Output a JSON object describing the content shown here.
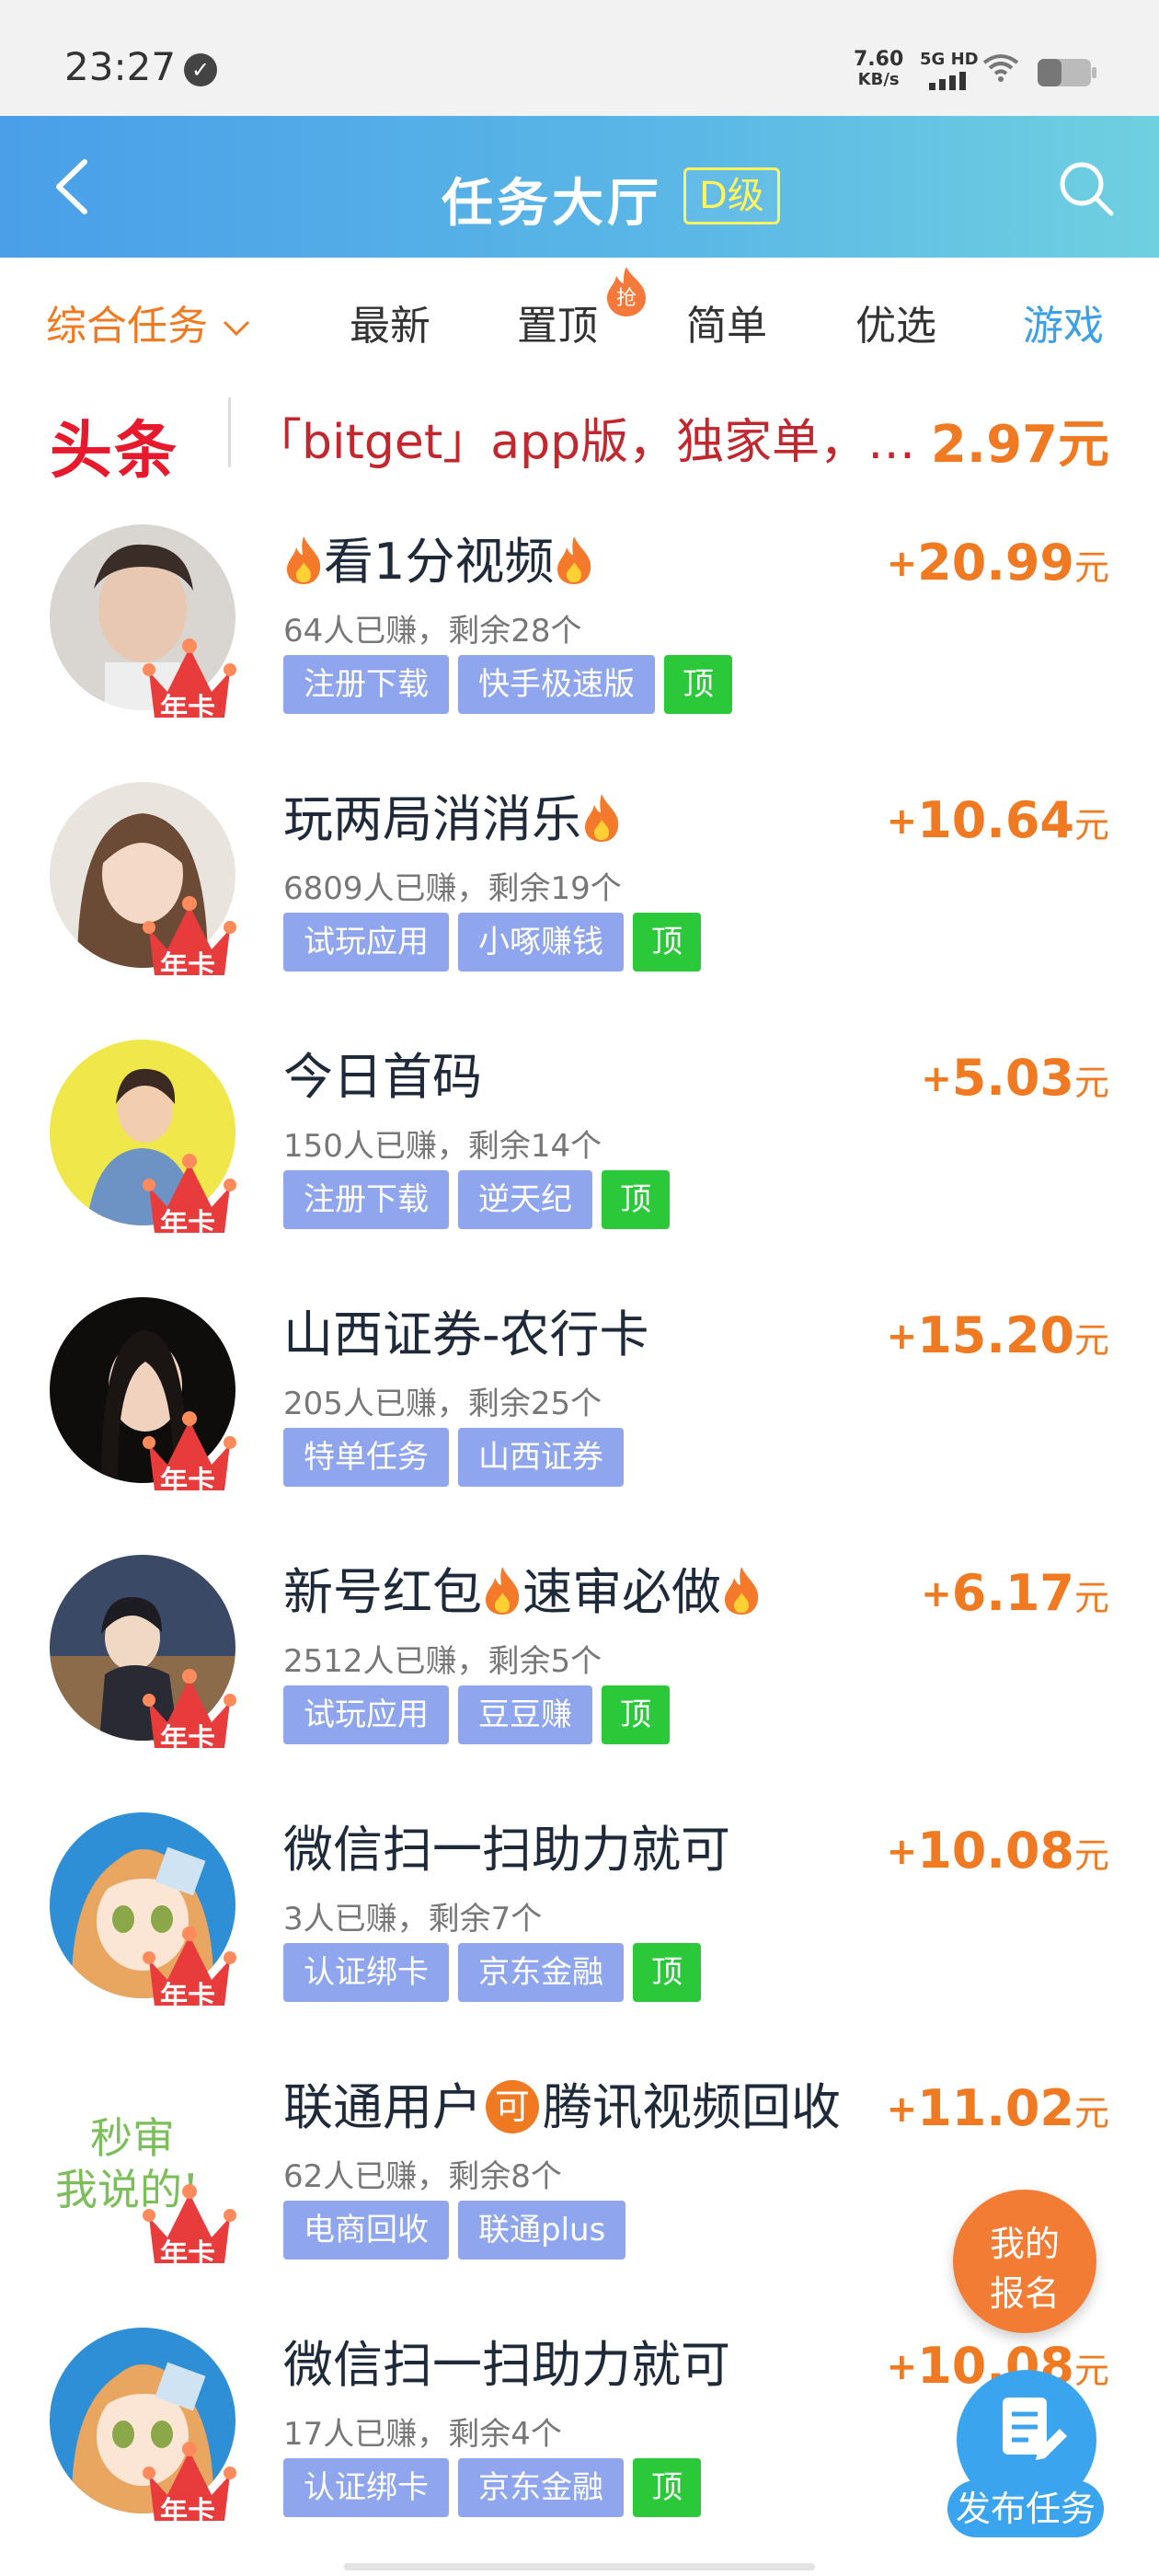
{
  "status_bar": {
    "time": "23:27",
    "speed_value": "7.60",
    "speed_unit": "KB/s",
    "network": "5G HD"
  },
  "header": {
    "title": "任务大厅",
    "level_badge": "D级"
  },
  "tabs": [
    {
      "label": "综合任务",
      "active": true
    },
    {
      "label": "最新"
    },
    {
      "label": "置顶",
      "badge": "抢"
    },
    {
      "label": "简单"
    },
    {
      "label": "优选"
    },
    {
      "label": "游戏"
    }
  ],
  "headline": {
    "logo": "头条",
    "text": "「bitget」app版，独家单，…",
    "price": "2.97元"
  },
  "tasks": [
    {
      "title": "看1分视频",
      "stats": "64人已赚，剩余28个",
      "tags": [
        "注册下载",
        "快手极速版",
        "顶"
      ],
      "reward_plus": "+",
      "reward_value": "20.99",
      "reward_unit": "元",
      "avatar_badge": "年卡",
      "avatar": "man-portrait"
    },
    {
      "title": "玩两局消消乐",
      "stats": "6809人已赚，剩余19个",
      "tags": [
        "试玩应用",
        "小啄赚钱",
        "顶"
      ],
      "reward_plus": "+",
      "reward_value": "10.64",
      "reward_unit": "元",
      "avatar_badge": "年卡",
      "avatar": "girl-portrait"
    },
    {
      "title": "今日首码",
      "stats": "150人已赚，剩余14个",
      "tags": [
        "注册下载",
        "逆天纪",
        "顶"
      ],
      "reward_plus": "+",
      "reward_value": "5.03",
      "reward_unit": "元",
      "avatar_badge": "年卡",
      "avatar": "cartoon-man"
    },
    {
      "title": "山西证券-农行卡",
      "stats": "205人已赚，剩余25个",
      "tags": [
        "特单任务",
        "山西证券"
      ],
      "reward_plus": "+",
      "reward_value": "15.20",
      "reward_unit": "元",
      "avatar_badge": "年卡",
      "avatar": "woman-portrait"
    },
    {
      "title_parts": [
        "新号红包",
        "速审必做"
      ],
      "stats": "2512人已赚，剩余5个",
      "tags": [
        "试玩应用",
        "豆豆赚",
        "顶"
      ],
      "reward_plus": "+",
      "reward_value": "6.17",
      "reward_unit": "元",
      "avatar_badge": "年卡",
      "avatar": "anime-boy"
    },
    {
      "title": "微信扫一扫助力就可",
      "stats": "3人已赚，剩余7个",
      "tags": [
        "认证绑卡",
        "京东金融",
        "顶"
      ],
      "reward_plus": "+",
      "reward_value": "10.08",
      "reward_unit": "元",
      "avatar_badge": "年卡",
      "avatar": "anime-girl"
    },
    {
      "title_parts": [
        "联通用户",
        "可",
        "腾讯视频回收"
      ],
      "stats": "62人已赚，剩余8个",
      "tags": [
        "电商回收",
        "联通plus"
      ],
      "reward_plus": "+",
      "reward_value": "11.02",
      "reward_unit": "元",
      "avatar_badge": "年卡",
      "avatar": "text-avatar",
      "avatar_text": [
        "秒审",
        "我说的!"
      ]
    },
    {
      "title": "微信扫一扫助力就可",
      "stats": "17人已赚，剩余4个",
      "tags": [
        "认证绑卡",
        "京东金融",
        "顶"
      ],
      "reward_plus": "+",
      "reward_value": "10.08",
      "reward_unit": "元",
      "avatar_badge": "年卡",
      "avatar": "anime-girl"
    }
  ],
  "fab_signup": {
    "line1": "我的",
    "line2": "报名"
  },
  "fab_publish": {
    "label": "发布任务"
  },
  "colors": {
    "accent": "#f07a22",
    "header_blue": "#4a9fe8",
    "tag_blue": "#8fa6ef",
    "tag_green": "#2bc93a",
    "headline_red": "#e8192c"
  }
}
